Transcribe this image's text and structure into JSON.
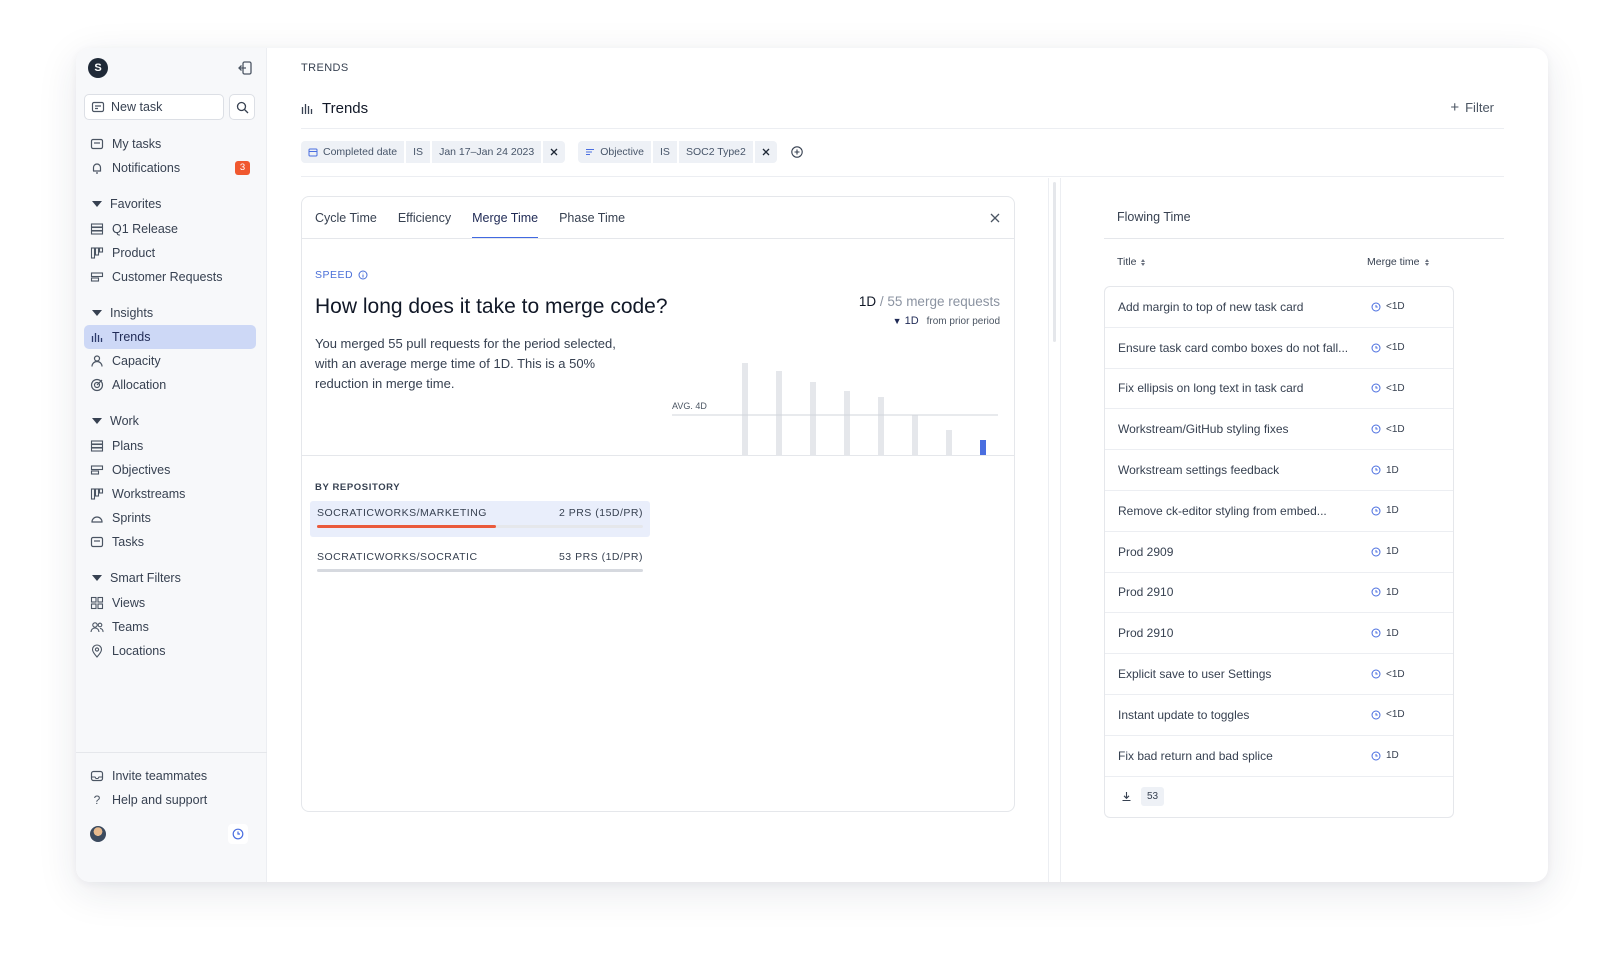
{
  "sidebar": {
    "logo": "S",
    "new_task_label": "New task",
    "items": {
      "my_tasks": "My tasks",
      "notifications": "Notifications",
      "notifications_count": "3"
    },
    "favorites": {
      "label": "Favorites",
      "items": [
        "Q1 Release",
        "Product",
        "Customer Requests"
      ]
    },
    "insights": {
      "label": "Insights",
      "items": [
        "Trends",
        "Capacity",
        "Allocation"
      ]
    },
    "work": {
      "label": "Work",
      "items": [
        "Plans",
        "Objectives",
        "Workstreams",
        "Sprints",
        "Tasks"
      ]
    },
    "smart_filters": {
      "label": "Smart Filters",
      "items": [
        "Views",
        "Teams",
        "Locations"
      ]
    },
    "footer": {
      "invite": "Invite teammates",
      "help": "Help and support"
    }
  },
  "header": {
    "breadcrumb": "TRENDS",
    "title": "Trends",
    "filter_label": "Filter"
  },
  "filters": [
    {
      "field": "Completed date",
      "op": "IS",
      "value": "Jan 17–Jan 24 2023"
    },
    {
      "field": "Objective",
      "op": "IS",
      "value": "SOC2 Type2"
    }
  ],
  "card": {
    "tabs": [
      "Cycle Time",
      "Efficiency",
      "Merge Time",
      "Phase Time"
    ],
    "active_tab": "Merge Time",
    "section_label": "SPEED",
    "question": "How long does it take to merge code?",
    "description": "You merged 55 pull requests for the period selected, with an average merge time of 1D. This is a 50% reduction in merge time.",
    "stat_value": "1D",
    "stat_rest": "/ 55 merge requests",
    "delta_value": "1D",
    "delta_label": "from prior period",
    "avg_label": "AVG. 4D",
    "by_repo_label": "BY REPOSITORY",
    "repos": [
      {
        "name": "SOCRATICWORKS/MARKETING",
        "stat": "2 PRS (15D/PR)",
        "fill": 0.55,
        "color": "#ea5a3b"
      },
      {
        "name": "SOCRATICWORKS/SOCRATIC",
        "stat": "53 PRS (1D/PR)",
        "fill": 0.0,
        "color": "#cfd3da"
      }
    ]
  },
  "chart_data": {
    "type": "bar",
    "categories": [
      "1",
      "2",
      "3",
      "4",
      "5",
      "6",
      "7",
      "8"
    ],
    "values": [
      9.2,
      8.4,
      7.3,
      6.4,
      5.8,
      4.0,
      2.5,
      1.5
    ],
    "avg": 4,
    "ylim": [
      0,
      10
    ],
    "bar_color": "#e5e7eb",
    "highlight_color": "#4a6ee0",
    "highlight_index": 7
  },
  "right_panel": {
    "title": "Flowing Time",
    "col_title": "Title",
    "col_merge": "Merge time",
    "rows": [
      {
        "title": "Add margin to top of new task card",
        "merge": "<1D"
      },
      {
        "title": "Ensure task card combo boxes do not fall...",
        "merge": "<1D"
      },
      {
        "title": "Fix ellipsis on long text in task card",
        "merge": "<1D"
      },
      {
        "title": "Workstream/GitHub styling fixes",
        "merge": "<1D"
      },
      {
        "title": "Workstream settings feedback",
        "merge": "1D"
      },
      {
        "title": "Remove ck-editor styling from embed...",
        "merge": "1D"
      },
      {
        "title": "Prod 2909",
        "merge": "1D"
      },
      {
        "title": "Prod 2910",
        "merge": "1D"
      },
      {
        "title": "Prod 2910",
        "merge": "1D"
      },
      {
        "title": "Explicit save to user Settings",
        "merge": "<1D"
      },
      {
        "title": "Instant update to toggles",
        "merge": "<1D"
      },
      {
        "title": "Fix bad return and bad splice",
        "merge": "1D"
      }
    ],
    "total_count": "53"
  }
}
